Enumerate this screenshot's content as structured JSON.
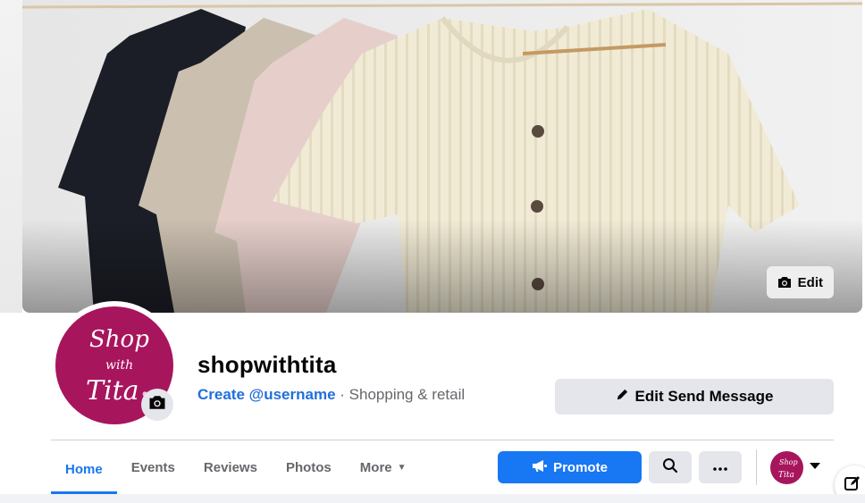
{
  "cover": {
    "edit_label": "Edit"
  },
  "profile": {
    "name": "shopwithtita",
    "create_username": "Create @username",
    "separator": " · ",
    "category": "Shopping & retail",
    "logo_text_1": "Shop",
    "logo_text_2": "with",
    "logo_text_3": "Tita"
  },
  "actions": {
    "edit_send_message": "Edit Send Message",
    "promote": "Promote"
  },
  "tabs": [
    {
      "label": "Home",
      "active": true
    },
    {
      "label": "Events"
    },
    {
      "label": "Reviews"
    },
    {
      "label": "Photos"
    },
    {
      "label": "More"
    }
  ],
  "icons": {
    "camera": "camera-icon",
    "pencil": "pencil-icon",
    "megaphone": "megaphone-icon",
    "search": "search-icon",
    "more": "ellipsis-icon",
    "caret": "caret-down-icon",
    "compose": "compose-icon"
  },
  "colors": {
    "accent": "#1877f2",
    "brand_magenta": "#a7155d",
    "button_grey": "#e4e6eb",
    "secondary_text": "#65676b"
  }
}
